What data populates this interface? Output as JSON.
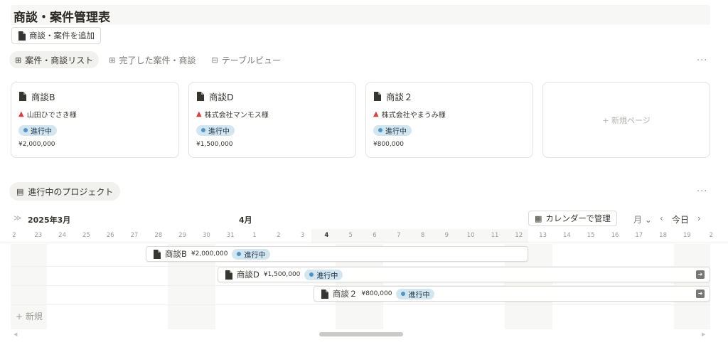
{
  "page": {
    "title": "商談・案件管理表"
  },
  "add_button": {
    "label": "商談・案件を追加"
  },
  "views": [
    {
      "label": "案件・商談リスト",
      "icon": "grid-icon",
      "active": true
    },
    {
      "label": "完了した案件・商談",
      "icon": "grid-icon",
      "active": false
    },
    {
      "label": "テーブルビュー",
      "icon": "table-icon",
      "active": false
    }
  ],
  "more_label": "···",
  "cards": [
    {
      "title": "商談B",
      "client": "山田ひでさき様",
      "status": "進行中",
      "amount": "¥2,000,000"
    },
    {
      "title": "商談D",
      "client": "株式会社マンモス様",
      "status": "進行中",
      "amount": "¥1,500,000"
    },
    {
      "title": "商談２",
      "client": "株式会社やまうみ様",
      "status": "進行中",
      "amount": "¥800,000"
    }
  ],
  "new_page_label": "+ 新規ページ",
  "projects_tab": {
    "label": "進行中のプロジェクト"
  },
  "timeline": {
    "arrows": "≫",
    "month_current": "2025年3月",
    "month_next": "4月",
    "calendar_button": "カレンダーで管理",
    "scale": "月 ⌄",
    "prev": "‹",
    "today": "今日",
    "next": "›",
    "days": [
      "2",
      "23",
      "24",
      "25",
      "26",
      "27",
      "28",
      "29",
      "30",
      "31",
      "1",
      "2",
      "3",
      "4",
      "5",
      "6",
      "7",
      "8",
      "9",
      "10",
      "11",
      "12",
      "13",
      "14",
      "15",
      "16",
      "17",
      "18",
      "19",
      "2"
    ],
    "bars": [
      {
        "title": "商談B",
        "amount": "¥2,000,000",
        "status": "進行中"
      },
      {
        "title": "商談D",
        "amount": "¥1,500,000",
        "status": "進行中"
      },
      {
        "title": "商談２",
        "amount": "¥800,000",
        "status": "進行中"
      }
    ],
    "new_row_label": "+ 新規"
  },
  "colors": {
    "status_pill_bg": "#d3e5ef",
    "status_dot": "#4d94c8",
    "person_icon": "#e03e3e"
  }
}
